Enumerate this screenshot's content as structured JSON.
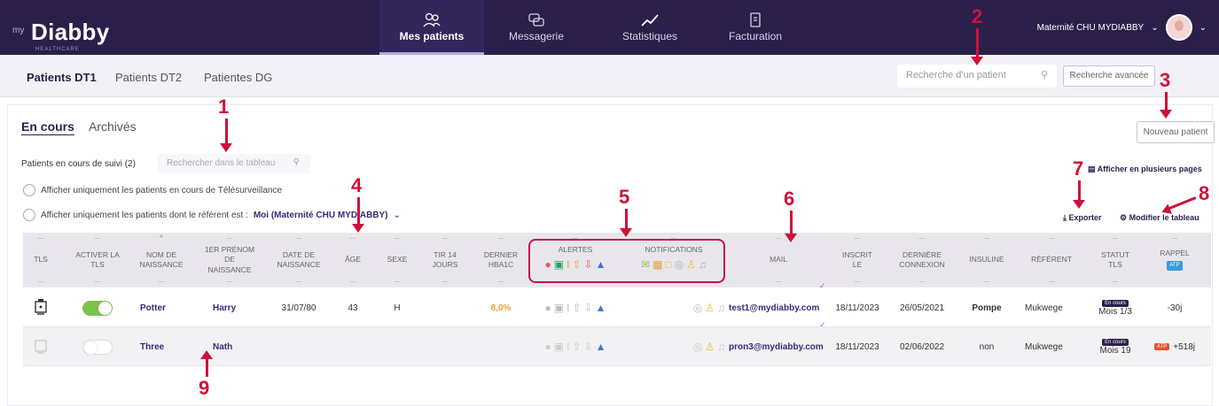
{
  "app": {
    "logo_prefix": "my",
    "logo_name": "Diabby",
    "logo_sub": "HEALTHCARE"
  },
  "nav": [
    {
      "label": "Mes patients",
      "icon": "patients-icon",
      "active": true
    },
    {
      "label": "Messagerie",
      "icon": "chat-icon",
      "active": false
    },
    {
      "label": "Statistiques",
      "icon": "stats-icon",
      "active": false
    },
    {
      "label": "Facturation",
      "icon": "billing-icon",
      "active": false
    }
  ],
  "account": {
    "label": "Maternité CHU MYDIABBY"
  },
  "patient_tabs": [
    "Patients DT1",
    "Patients DT2",
    "Patientes DG"
  ],
  "search": {
    "placeholder": "Recherche d'un patient",
    "advanced_label": "Recherche avancée"
  },
  "status_tabs": [
    "En cours",
    "Archivés"
  ],
  "new_patient_label": "Nouveau patient",
  "followup_label": "Patients en cours de suivi (2)",
  "table_search_placeholder": "Rechercher dans le tableau",
  "filters": {
    "tls_only": "Afficher uniquement les patients en cours de Télésurveillance",
    "referent_prefix": "Afficher uniquement les patients dont le référent est :",
    "referent_value": "Moi (Maternité CHU MYDIABBY)"
  },
  "links": {
    "multi_pages": "Afficher en plusieurs pages",
    "export": "Exporter",
    "modify": "Modifier le tableau"
  },
  "columns": [
    "TLS",
    "ACTIVER LA TLS",
    "NOM DE NAISSANCE",
    "1ER PRÉNOM DE NAISSANCE",
    "DATE DE NAISSANCE",
    "ÂGE",
    "SEXE",
    "TIR 14 JOURS",
    "DERNIER HBA1C",
    "ALERTES",
    "NOTIFICATIONS",
    "MAIL",
    "INSCRIT LE",
    "DERNIÈRE CONNEXION",
    "INSULINE",
    "RÉFÉRENT",
    "STATUT TLS",
    "RAPPEL"
  ],
  "rappel_badge": "ATP",
  "rows": [
    {
      "tls_active": true,
      "nom": "Potter",
      "prenom": "Harry",
      "naissance": "31/07/80",
      "age": "43",
      "sexe": "H",
      "tir": "",
      "hba1c": "8,0%",
      "mail": "test1@mydiabby.com",
      "inscrit": "18/11/2023",
      "connexion": "26/05/2021",
      "insuline": "Pompe",
      "referent": "Mukwege",
      "statut_badge": "En cours",
      "statut": "Mois 1/3",
      "rappel": "-30j",
      "rappel_badge": ""
    },
    {
      "tls_active": false,
      "nom": "Three",
      "prenom": "Nath",
      "naissance": "",
      "age": "",
      "sexe": "",
      "tir": "",
      "hba1c": "",
      "mail": "pron3@mydiabby.com",
      "inscrit": "18/11/2023",
      "connexion": "02/06/2022",
      "insuline": "non",
      "referent": "Mukwege",
      "statut_badge": "En cours",
      "statut": "Mois 19",
      "rappel": "+518j",
      "rappel_badge": "ATP"
    }
  ],
  "annotations": [
    "1",
    "2",
    "3",
    "4",
    "5",
    "6",
    "7",
    "8",
    "9"
  ]
}
